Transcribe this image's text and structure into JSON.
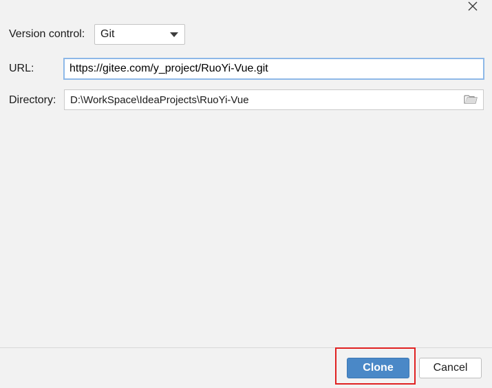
{
  "dialog": {
    "close_icon": "close-icon"
  },
  "version_control": {
    "label": "Version control:",
    "selected": "Git"
  },
  "url": {
    "label": "URL:",
    "value": "https://gitee.com/y_project/RuoYi-Vue.git"
  },
  "directory": {
    "label": "Directory:",
    "value": "D:\\WorkSpace\\IdeaProjects\\RuoYi-Vue",
    "browse_icon": "folder-icon"
  },
  "buttons": {
    "clone_label": "Clone",
    "cancel_label": "Cancel"
  },
  "colors": {
    "accent": "#4a88c7",
    "focus_border": "#8db8e8",
    "highlight": "#e02020",
    "background": "#f2f2f2"
  }
}
